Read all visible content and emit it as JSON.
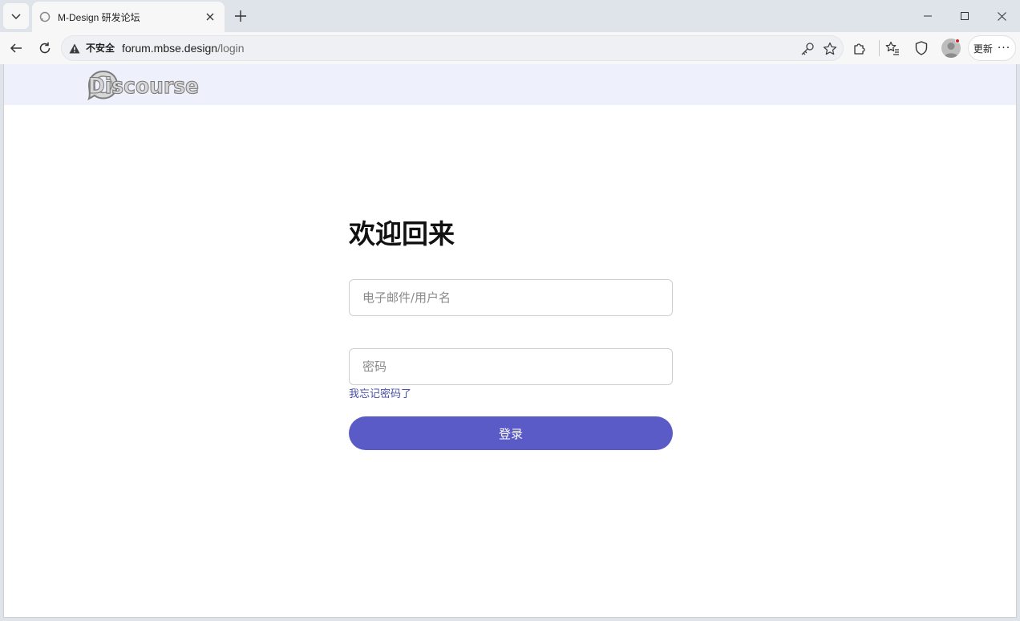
{
  "browser": {
    "tab": {
      "title": "M-Design 研发论坛"
    },
    "address": {
      "security_label": "不安全",
      "domain": "forum.mbse.design",
      "path": "/login"
    },
    "update_label": "更新",
    "more_label": "···"
  },
  "site": {
    "logo_text": "Discourse"
  },
  "login": {
    "title": "欢迎回来",
    "username_placeholder": "电子邮件/用户名",
    "password_placeholder": "密码",
    "forgot_label": "我忘记密码了",
    "submit_label": "登录"
  },
  "colors": {
    "accent": "#5a5bc6",
    "link": "#4a51a8",
    "header_bg": "#eef0fb"
  }
}
